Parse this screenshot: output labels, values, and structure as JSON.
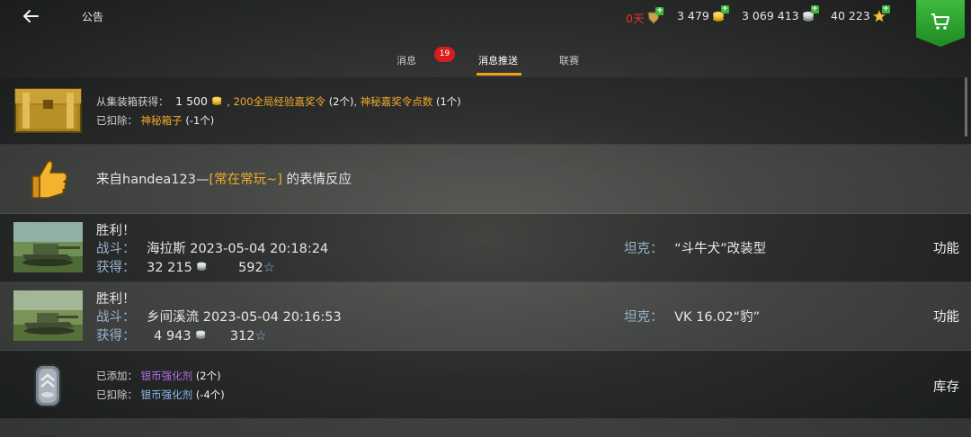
{
  "header": {
    "title": "公告",
    "premium_days": "0天",
    "gold": "3 479",
    "credits": "3 069 413",
    "free_xp": "40 223"
  },
  "tabs": [
    {
      "label": "消息",
      "badge": "19"
    },
    {
      "label": "消息推送"
    },
    {
      "label": "联赛"
    }
  ],
  "messages": {
    "crate": {
      "line1_prefix": "从集装箱获得：",
      "gold_amount": "1 500",
      "sep1": ",",
      "reward2": "200全局经验嘉奖令",
      "reward2_count": "(2个)",
      "sep2": ",",
      "reward3": "神秘嘉奖令点数",
      "reward3_count": "(1个)",
      "line2_prefix": "已扣除：",
      "deducted_item": "神秘箱子",
      "deducted_count": "(-1个)"
    },
    "reaction": {
      "prefix": "来自handea123—",
      "clan": "[常在常玩~]",
      "suffix": " 的表情反应"
    },
    "battles": [
      {
        "title": "胜利！",
        "battle_label": "战斗：",
        "battle_info": "海拉斯 2023-05-04 20:18:24",
        "earned_label": "获得：",
        "credits": "32 215",
        "xp": "592",
        "tank_label": "坦克：",
        "tank_name": "“斗牛犬”改装型",
        "action": "功能"
      },
      {
        "title": "胜利！",
        "battle_label": "战斗：",
        "battle_info": "乡间溪流 2023-05-04 20:16:53",
        "earned_label": "获得：",
        "credits": "4 943",
        "xp": "312",
        "tank_label": "坦克：",
        "tank_name": "VK 16.02“豹”",
        "action": "功能"
      }
    ],
    "consumable": {
      "added_label": "已添加：",
      "added_item": "银币强化剂",
      "added_count": "(2个)",
      "deducted_label": "已扣除：",
      "deducted_item": "银币强化剂",
      "deducted_count": "(-4个)",
      "action": "库存"
    }
  },
  "colors": {
    "accent": "#f0a21a",
    "badge": "#d91c1c",
    "premium": "#e8332e",
    "shop": "#2ea32f",
    "reward_gold": "#f2a92c",
    "consumable_purple": "#b469e6",
    "consumable_blue": "#8fb6ee"
  }
}
